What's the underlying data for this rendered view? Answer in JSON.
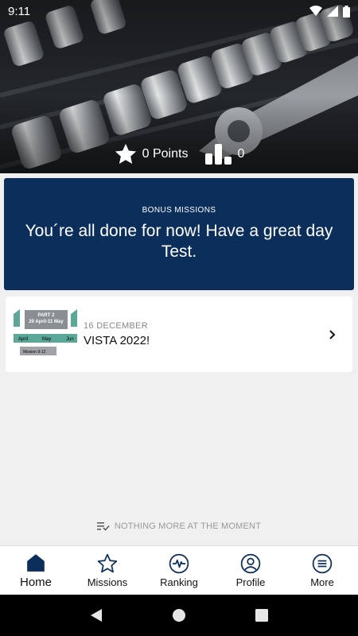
{
  "status_bar": {
    "time": "9:11"
  },
  "stats": {
    "points": "0 Points",
    "rank": "0"
  },
  "bonus": {
    "label": "BONUS MISSIONS",
    "message": "You´re all done for now! Have a great day Test."
  },
  "missions": [
    {
      "date": "16 DECEMBER",
      "title": "VISTA 2022!",
      "thumb": {
        "part": "PART 2",
        "dates": "20 April-11 May",
        "months": [
          "April",
          "May",
          "Jun"
        ],
        "mission": "Mission 9-12"
      }
    }
  ],
  "footer_note": "NOTHING MORE AT THE MOMENT",
  "bottom_nav": [
    {
      "label": "Home",
      "icon": "home-icon"
    },
    {
      "label": "Missions",
      "icon": "star-icon"
    },
    {
      "label": "Ranking",
      "icon": "ranking-icon"
    },
    {
      "label": "Profile",
      "icon": "profile-icon"
    },
    {
      "label": "More",
      "icon": "menu-icon"
    }
  ],
  "colors": {
    "primary": "#0c2e5a",
    "background": "#f0f0f0",
    "thumb_teal": "#5aa898"
  }
}
